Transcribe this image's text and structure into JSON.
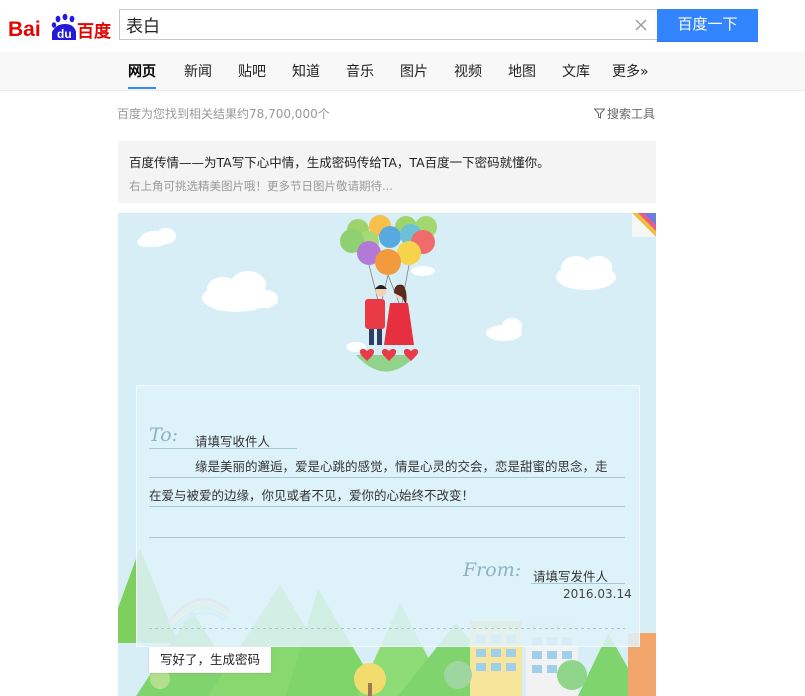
{
  "header": {
    "logo": {
      "text_bai": "Bai",
      "text_du": "du",
      "text_cn": "百度"
    },
    "search": {
      "value": "表白",
      "button_label": "百度一下"
    }
  },
  "tabs": [
    {
      "label": "网页",
      "active": true
    },
    {
      "label": "新闻"
    },
    {
      "label": "贴吧"
    },
    {
      "label": "知道"
    },
    {
      "label": "音乐"
    },
    {
      "label": "图片"
    },
    {
      "label": "视频"
    },
    {
      "label": "地图"
    },
    {
      "label": "文库"
    },
    {
      "label": "更多»"
    }
  ],
  "results": {
    "count_text": "百度为您找到相关结果约78,700,000个",
    "tools_label": "搜索工具"
  },
  "info": {
    "title": "百度传情——为TA写下心中情，生成密码传给TA，TA百度一下密码就懂你。",
    "subtitle": "右上角可挑选精美图片哦！更多节日图片敬请期待..."
  },
  "letter": {
    "to_script": "To:",
    "to_placeholder": "请填写收件人",
    "message_line1": "缘是美丽的邂逅，爱是心跳的感觉，情是心灵的交会，恋是甜蜜的思念，走",
    "message_line2": "在爱与被爱的边缘，你见或者不见，爱你的心始终不改变！",
    "from_script": "From:",
    "from_placeholder": "请填写发件人",
    "date": "2016.03.14",
    "generate_button": "写好了，生成密码"
  },
  "colors": {
    "accent": "#3385ff",
    "logo_red": "#e10602",
    "logo_blue": "#2319dc",
    "card_sky": "#d7eef7"
  }
}
